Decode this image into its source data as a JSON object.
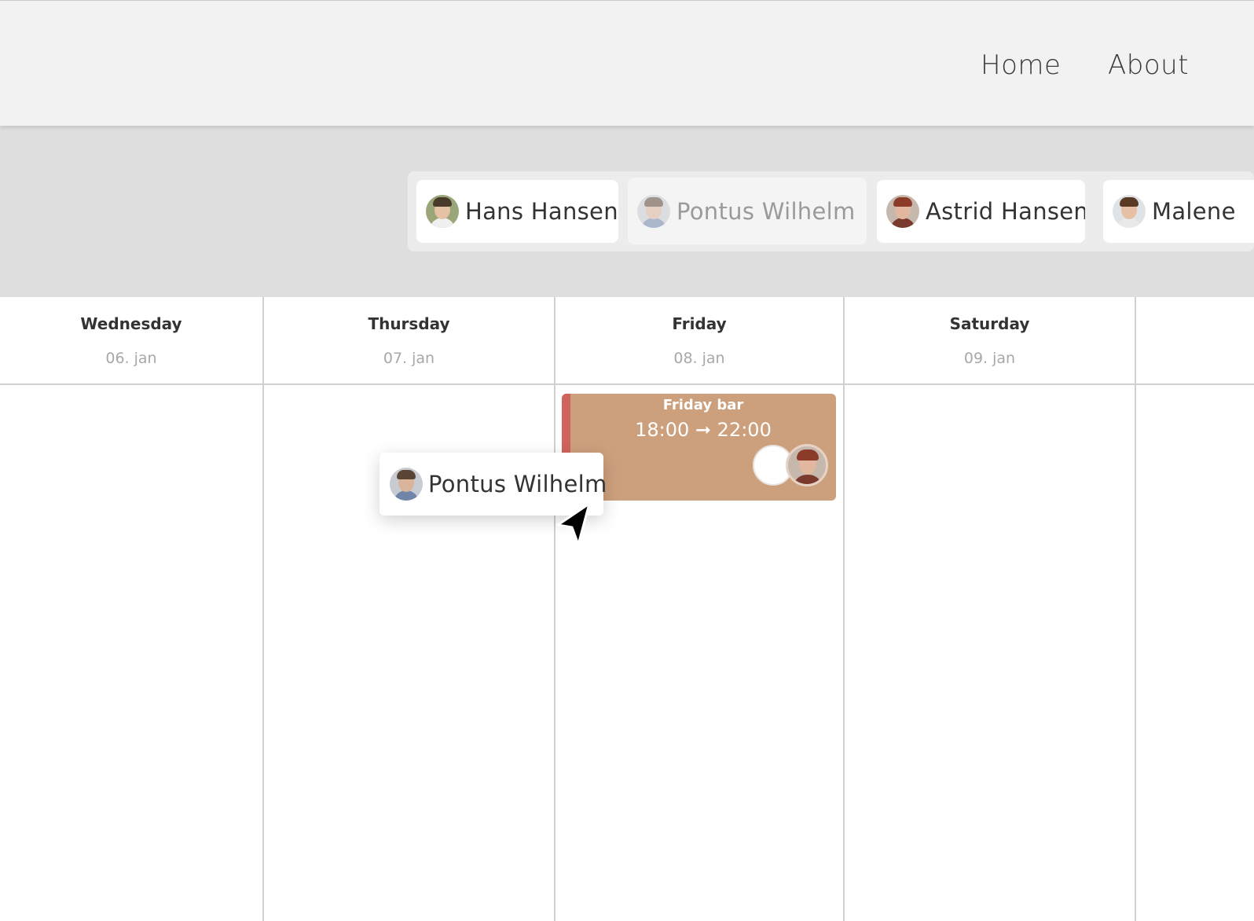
{
  "nav": {
    "home": "Home",
    "about": "About"
  },
  "people": [
    {
      "name": "Hans Hansen",
      "avatar": "avatar-hans-icon"
    },
    {
      "name": "Pontus Wilhelm",
      "avatar": "avatar-pontus-icon",
      "state": "being-dragged"
    },
    {
      "name": "Astrid Hansen",
      "avatar": "avatar-astrid-icon"
    },
    {
      "name": "Malene",
      "avatar": "avatar-malene-icon"
    }
  ],
  "days": [
    {
      "name": "Wednesday",
      "date": "06. jan"
    },
    {
      "name": "Thursday",
      "date": "07. jan"
    },
    {
      "name": "Friday",
      "date": "08. jan"
    },
    {
      "name": "Saturday",
      "date": "09. jan"
    }
  ],
  "event": {
    "title": "Friday bar",
    "time": "18:00 ➞ 22:00",
    "color": "#cda07d",
    "stripe_color": "#d0635b",
    "assignees": [
      "empty-slot",
      "Astrid Hansen"
    ]
  },
  "drag_ghost": {
    "name": "Pontus Wilhelm"
  },
  "colors": {
    "header_bg": "#f2f2f2",
    "people_band_bg": "#dedede",
    "grid_line": "#d0d0d0"
  }
}
